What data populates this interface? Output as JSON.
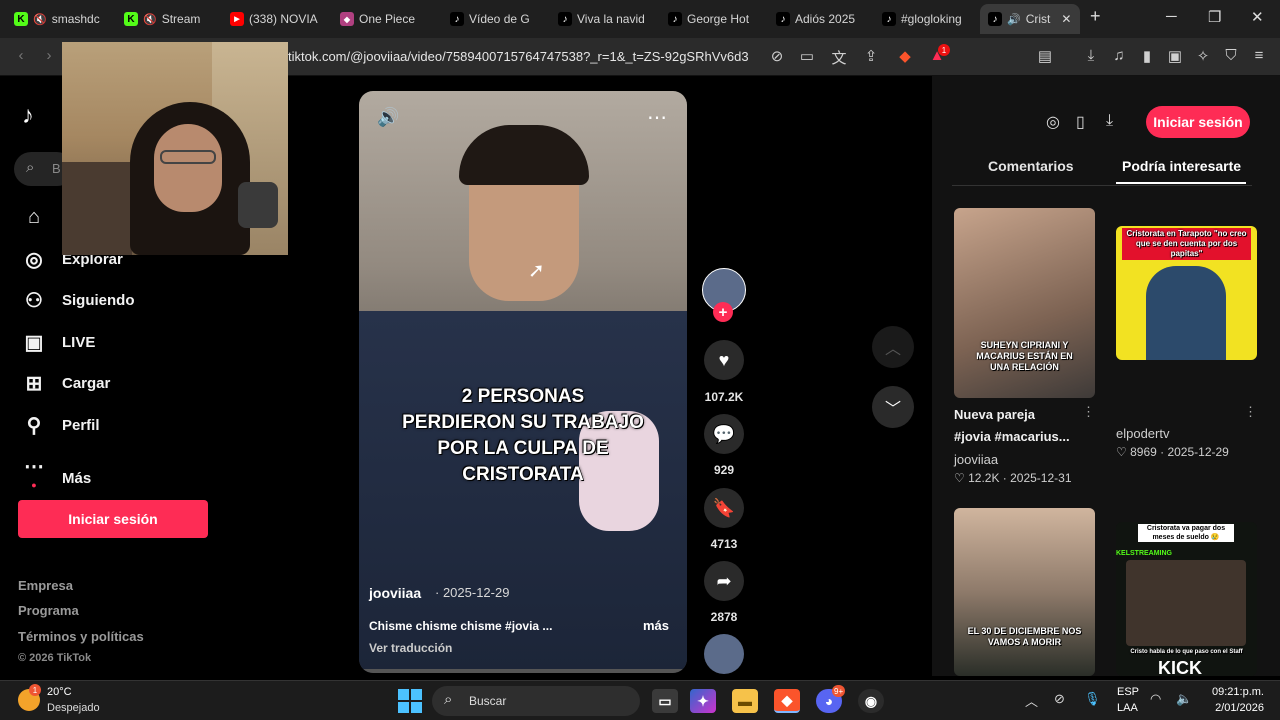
{
  "browser": {
    "tabs": [
      {
        "title": "smashdc",
        "favicon": "K",
        "color": "#53fc18",
        "muted": true
      },
      {
        "title": "Stream",
        "favicon": "K",
        "color": "#53fc18",
        "muted": true
      },
      {
        "title": "(338) NOVIA",
        "favicon": "▶",
        "color": "#ff0000",
        "muted": false
      },
      {
        "title": "One Piece",
        "favicon": "◆",
        "color": "#b04080",
        "muted": false
      },
      {
        "title": "Vídeo de G",
        "favicon": "♪",
        "color": "#000000",
        "muted": false
      },
      {
        "title": "Viva la navid",
        "favicon": "♪",
        "color": "#000000",
        "muted": false
      },
      {
        "title": "George Hot",
        "favicon": "♪",
        "color": "#000000",
        "muted": false
      },
      {
        "title": "Adiós 2025",
        "favicon": "♪",
        "color": "#000000",
        "muted": false
      },
      {
        "title": "#glogloking",
        "favicon": "♪",
        "color": "#000000",
        "muted": false
      },
      {
        "title": "Crist",
        "favicon": "♪",
        "color": "#000000",
        "muted": false
      }
    ],
    "url": "tiktok.com/@jooviiaa/video/7589400715764747538?_r=1&_t=ZS-92gSRhVv6d3",
    "brave_badge": "1"
  },
  "sidebar": {
    "search_placeholder": "B",
    "nav": [
      {
        "label": "Explorar",
        "icon": "compass-icon"
      },
      {
        "label": "Siguiendo",
        "icon": "user-follow-icon"
      },
      {
        "label": "LIVE",
        "icon": "live-icon"
      },
      {
        "label": "Cargar",
        "icon": "upload-icon"
      },
      {
        "label": "Perfil",
        "icon": "profile-icon"
      },
      {
        "label": "Más",
        "icon": "more-icon"
      }
    ],
    "login_label": "Iniciar sesión",
    "footer": [
      "Empresa",
      "Programa",
      "Términos y políticas"
    ],
    "copyright": "© 2026 TikTok"
  },
  "video": {
    "caption_lines": [
      "2 PERSONAS",
      "PERDIERON SU TRABAJO",
      "POR LA CULPA DE",
      "CRISTORATA"
    ],
    "author": "jooviiaa",
    "date": "· 2025-12-29",
    "description": "Chisme chisme chisme #jovia ...",
    "more_label": "más",
    "translate_label": "Ver traducción"
  },
  "actions": {
    "likes": "107.2K",
    "comments": "929",
    "saves": "4713",
    "shares": "2878"
  },
  "right_panel": {
    "login_label": "Iniciar sesión",
    "tabs": [
      "Comentarios",
      "Podría interesarte"
    ],
    "cards": [
      {
        "title_line1": "Nueva pareja",
        "title_line2": "#jovia #macarius...",
        "author": "jooviiaa",
        "stats": "♡ 12.2K · 2025-12-31",
        "thumb_caption": "SUHEYN CIPRIANI Y MACARIUS ESTÁN EN UNA RELACIÓN"
      },
      {
        "author": "elpodertv",
        "stats": "♡ 8969 · 2025-12-29",
        "thumb_caption": "Cristorata en Tarapoto \"no creo que se den cuenta por dos papitas\""
      },
      {
        "thumb_caption": "EL 30 DE DICIEMBRE NOS VAMOS A MORIR"
      },
      {
        "thumb_caption": "Cristorata va pagar dos meses de sueldo 😢",
        "thumb_caption2": "Cristo habla de lo que paso con el Staff",
        "thumb_label": "KICK",
        "thumb_badge": "KELSTREAMING"
      }
    ]
  },
  "taskbar": {
    "weather_temp": "20°C",
    "weather_desc": "Despejado",
    "weather_badge": "1",
    "search_label": "Buscar",
    "lang_line1": "ESP",
    "lang_line2": "LAA",
    "time": "09:21:p.m.",
    "date": "2/01/2026",
    "discord_badge": "9+"
  },
  "colors": {
    "accent": "#fe2c55",
    "kick_green": "#53fc18"
  }
}
